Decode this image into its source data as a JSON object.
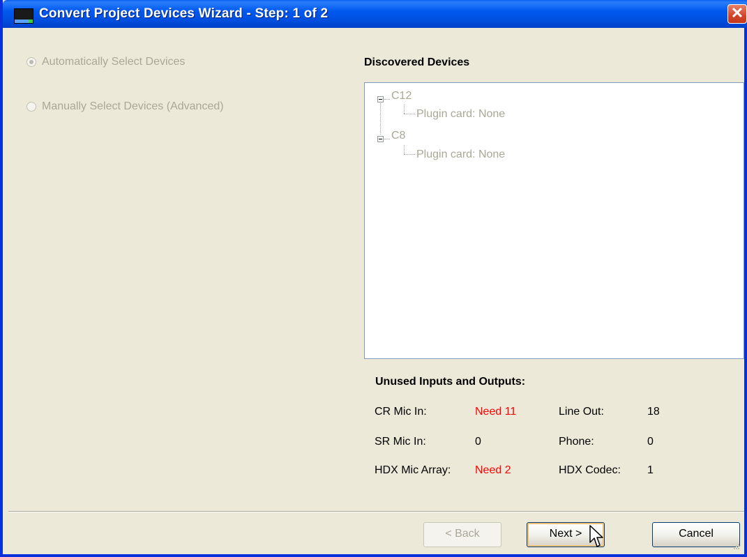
{
  "window": {
    "title": "Convert Project Devices Wizard - Step: 1 of 2",
    "close_glyph": "✕"
  },
  "selection": {
    "auto_label": "Automatically Select Devices",
    "manual_label": "Manually Select Devices (Advanced)",
    "selected": "auto"
  },
  "discovered": {
    "heading": "Discovered Devices",
    "devices": [
      {
        "name": "C12",
        "child": "Plugin card: None"
      },
      {
        "name": "C8",
        "child": "Plugin card: None"
      }
    ]
  },
  "unused": {
    "heading": "Unused Inputs and Outputs:",
    "left": [
      {
        "label": "CR Mic In:",
        "value": "Need 11",
        "warn": true
      },
      {
        "label": "SR Mic In:",
        "value": "0",
        "warn": false
      },
      {
        "label": "HDX Mic Array:",
        "value": "Need 2",
        "warn": true
      }
    ],
    "right": [
      {
        "label": "Line Out:",
        "value": "18"
      },
      {
        "label": "Phone:",
        "value": "0"
      },
      {
        "label": "HDX Codec:",
        "value": "1"
      }
    ]
  },
  "buttons": {
    "back": "< Back",
    "next": "Next >",
    "cancel": "Cancel"
  },
  "colors": {
    "title_bar": "#0058ee",
    "warning": "#ff0000",
    "disabled_text": "#a9a796"
  },
  "icons": {
    "app": "app-icon",
    "close": "close-icon",
    "cursor": "mouse-pointer-icon"
  }
}
